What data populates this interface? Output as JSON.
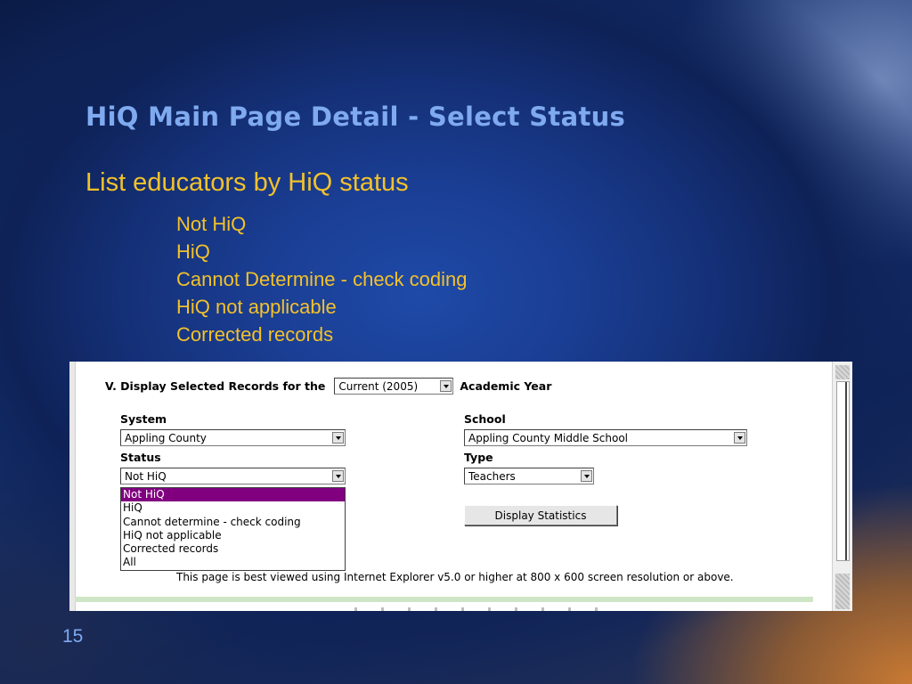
{
  "slide": {
    "title": "HiQ Main Page Detail - Select Status",
    "subtitle": "List educators by HiQ status",
    "status_items": [
      "Not HiQ",
      "HiQ",
      "Cannot Determine - check coding",
      "HiQ not applicable",
      "Corrected records"
    ],
    "page_number": "15"
  },
  "form": {
    "heading": "V. Display Selected Records for the",
    "year_select": "Current (2005)",
    "heading_suffix": "Academic Year",
    "system_label": "System",
    "system_value": "Appling County",
    "school_label": "School",
    "school_value": "Appling County Middle School",
    "status_label": "Status",
    "status_value": "Not HiQ",
    "type_label": "Type",
    "type_value": "Teachers",
    "status_options": [
      "Not HiQ",
      "HiQ",
      "Cannot determine - check coding",
      "HiQ not applicable",
      "Corrected records",
      "All"
    ],
    "display_button": "Display Statistics",
    "footer_note": "This page is best viewed using Internet Explorer v5.0 or higher at 800 x 600 screen resolution or above."
  },
  "colors": {
    "title": "#7faaf0",
    "body_text": "#f3c12a",
    "selected_option": "#800080"
  }
}
